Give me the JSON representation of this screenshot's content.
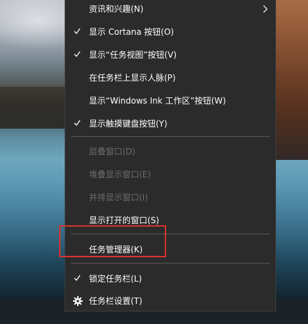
{
  "menu": {
    "items": [
      {
        "label": "资讯和兴趣(N)",
        "checked": false,
        "disabled": false,
        "submenu": true
      },
      {
        "label": "显示 Cortana 按钮(O)",
        "checked": true,
        "disabled": false
      },
      {
        "label": "显示“任务视图”按钮(V)",
        "checked": true,
        "disabled": false
      },
      {
        "label": "在任务栏上显示人脉(P)",
        "checked": false,
        "disabled": false
      },
      {
        "label": "显示“Windows Ink 工作区”按钮(W)",
        "checked": false,
        "disabled": false
      },
      {
        "label": "显示触摸键盘按钮(Y)",
        "checked": true,
        "disabled": false
      },
      {
        "label": "层叠窗口(D)",
        "checked": false,
        "disabled": true
      },
      {
        "label": "堆叠显示窗口(E)",
        "checked": false,
        "disabled": true
      },
      {
        "label": "并排显示窗口(I)",
        "checked": false,
        "disabled": true
      },
      {
        "label": "显示打开的窗口(S)",
        "checked": false,
        "disabled": false
      },
      {
        "label": "任务管理器(K)",
        "checked": false,
        "disabled": false,
        "highlighted": true
      },
      {
        "label": "锁定任务栏(L)",
        "checked": true,
        "disabled": false
      },
      {
        "label": "任务栏设置(T)",
        "checked": false,
        "disabled": false,
        "icon": "gear-icon"
      }
    ]
  },
  "colors": {
    "menu_background": "#2b2b2b",
    "menu_text": "#ffffff",
    "disabled_text": "#6d6d6d",
    "separator": "#5a5a5a",
    "highlight_border": "#d7322e"
  }
}
